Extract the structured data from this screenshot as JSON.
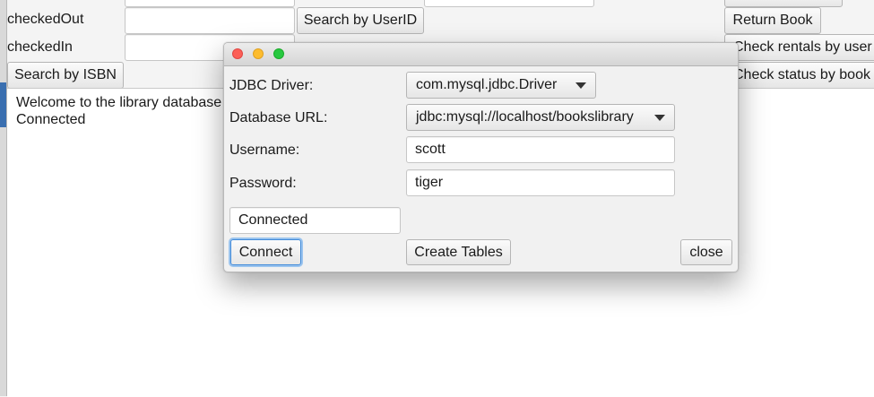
{
  "main": {
    "labels": {
      "checked_out": "checkedOut",
      "checked_in": "checkedIn"
    },
    "buttons": {
      "search_by_userid": "Search by UserID",
      "search_by_isbn": "Search by ISBN",
      "return_book": "Return Book",
      "check_rentals": "Check rentals by user i",
      "check_status": "Check status by book"
    },
    "fields": {
      "checked_out": "",
      "checked_in": ""
    },
    "console": {
      "line1": "Welcome to the library database c",
      "line2": "Connected"
    }
  },
  "dialog": {
    "labels": {
      "driver": "JDBC Driver:",
      "url": "Database URL:",
      "username": "Username:",
      "password": "Password:"
    },
    "driver_value": "com.mysql.jdbc.Driver",
    "url_value": "jdbc:mysql://localhost/bookslibrary",
    "username_value": "scott",
    "password_value": "tiger",
    "status_value": "Connected",
    "buttons": {
      "connect": "Connect",
      "create_tables": "Create Tables",
      "close": "close"
    }
  },
  "colors": {
    "close_light": "#fc5f57",
    "minimize_light": "#fdbc2e",
    "zoom_light": "#28c840",
    "focus_ring": "#549eeb"
  }
}
